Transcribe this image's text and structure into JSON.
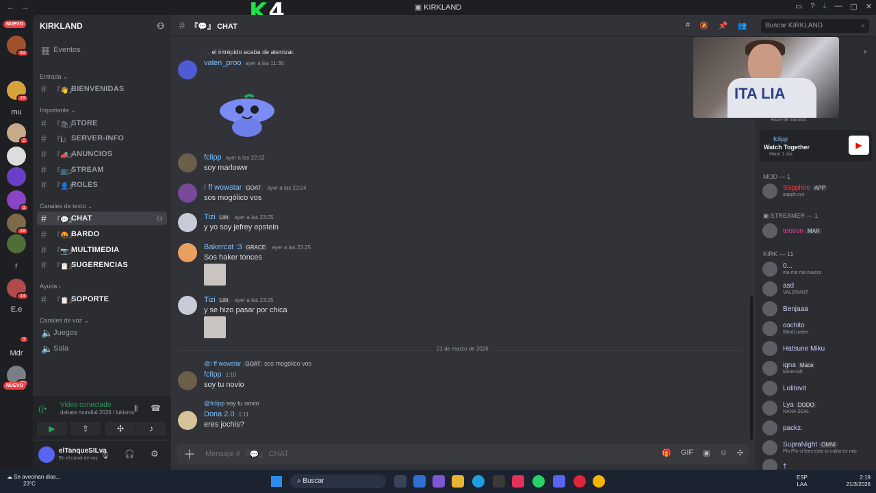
{
  "window": {
    "title": "KIRKLAND",
    "overlay_logo_k": "K",
    "overlay_logo_4": "4"
  },
  "rail": {
    "new_badge": "NUEVO",
    "servers": [
      {
        "label": "",
        "badge": "51",
        "color": "#a0522d"
      },
      {
        "label": "",
        "badge": "19",
        "color": "#d8a23a"
      },
      {
        "label": "mu",
        "badge": "",
        "color": "#1e1f22"
      },
      {
        "label": "",
        "badge": "2",
        "color": "#c8a98a"
      },
      {
        "label": "",
        "badge": "",
        "color": "#ddd"
      },
      {
        "label": "",
        "badge": "",
        "color": "#6a3fc7"
      },
      {
        "label": "",
        "badge": "1",
        "color": "#8a44c7"
      },
      {
        "label": "",
        "badge": "18",
        "color": "#7c6a4a"
      },
      {
        "label": "",
        "badge": "",
        "color": "#4f6e3a"
      },
      {
        "label": "r",
        "badge": "",
        "color": "#1e1f22"
      },
      {
        "label": "",
        "badge": "14",
        "color": "#b24a4a"
      },
      {
        "label": "E.e",
        "badge": "",
        "color": "#1e1f22"
      },
      {
        "label": "",
        "badge": "1",
        "color": "#1e1f22"
      },
      {
        "label": "Mdr",
        "badge": "",
        "color": "#1e1f22"
      },
      {
        "label": "",
        "badge": "20",
        "color": "#7a7f86"
      }
    ]
  },
  "sidebar": {
    "guild_name": "KIRKLAND",
    "events": "Eventos",
    "categories": {
      "entrada": "Entrada",
      "importante": "Importante",
      "texto": "Canales de texto",
      "ayuda": "Ayuda",
      "voz": "Canales de voz"
    },
    "channels": {
      "bienvenidas": "BIENVENIDAS",
      "store": "STORE",
      "server_info": "SERVER-INFO",
      "anuncios": "ANUNCIOS",
      "stream": "STREAM",
      "roles": "ROLES",
      "chat": "CHAT",
      "bardo": "BARDO",
      "multimedia": "MULTIMEDIA",
      "sugerencias": "SUGERENCIAS",
      "soporte": "SOPORTE",
      "juegos": "Juegos",
      "sala": "Sala"
    },
    "voice": {
      "status": "Video conectado",
      "detail": "debate mundial 2026 / lukismo"
    },
    "user": {
      "name": "elTanqueSILva",
      "status": "En el canal de voz"
    }
  },
  "header": {
    "channel": "CHAT",
    "search_placeholder": "Buscar KIRKLAND"
  },
  "messages": {
    "system": "el intrépido acaba de aterrizar.",
    "m1": {
      "user": "valen_proo",
      "time": "ayer a las 11:30"
    },
    "m2": {
      "user": "fclipp",
      "time": "ayer a las 22:52",
      "text": "soy marloww"
    },
    "m3": {
      "user": "! ff wowstar",
      "tag": "GOAT",
      "time": "ayer a las 23:24",
      "text": "sos mogólico vos"
    },
    "m4": {
      "user": "Tizi",
      "tag": "Lith",
      "time": "ayer a las 23:25",
      "text": "y yo soy jefrey epstein"
    },
    "m5": {
      "user": "Bakercat :3",
      "tag": "GRACE",
      "time": "ayer a las 23:25",
      "text": "Sos haker tonces"
    },
    "m6": {
      "user": "Tizi",
      "tag": "Lith",
      "time": "ayer a las 23:25",
      "text": "y se hizo pasar por chica"
    },
    "date_divider": "21 de marzo de 2026",
    "m7": {
      "reply_user": "@! ff wowstar",
      "reply_tag": "GOAT",
      "reply_text": "sos mogólico vos",
      "user": "fclipp",
      "time": "1:10",
      "text": "soy tu novio"
    },
    "m8": {
      "reply_user": "@fclipp",
      "reply_text": "soy tu novio",
      "user": "Dona 2.0",
      "time": "1:11",
      "text": "eres jochis?"
    }
  },
  "composer": {
    "placeholder": "Mensaje #",
    "channel": "CHAT"
  },
  "members": {
    "activity_time": "Hace 58 minutos",
    "activity": {
      "user": "fclipp",
      "title": "Watch Together",
      "time": "Hace 1 día"
    },
    "sections": {
      "mod": "MOD — 1",
      "streamer": "STREAMER — 1",
      "kirk": "KIRK — 11"
    },
    "mod": [
      {
        "name": "Sapphire",
        "tag": "APP",
        "status": "sapph.xyz",
        "color": "#f23f43"
      }
    ],
    "streamer": [
      {
        "name": "teoson",
        "tag": "MAR",
        "status": "",
        "color": "#eb459e"
      }
    ],
    "kirk": [
      {
        "name": "0...",
        "status": "ma ma ma maicra"
      },
      {
        "name": "asd",
        "status": "VALORANT"
      },
      {
        "name": "Benjaaa",
        "status": ""
      },
      {
        "name": "cochito",
        "status": "tModLoader"
      },
      {
        "name": "Hatsune Miku",
        "status": ""
      },
      {
        "name": "igna",
        "tag": "Mace",
        "status": "Minecraft"
      },
      {
        "name": "Lolitovit",
        "status": ""
      },
      {
        "name": "Lya",
        "tag": "DODO",
        "status": "NANA SEAL"
      },
      {
        "name": "packz.",
        "status": ""
      },
      {
        "name": "SupraNight",
        "tag": "OMNI",
        "status": "Plo Plo si lees esto tu culito es mio"
      },
      {
        "name": "†",
        "status": ""
      }
    ]
  },
  "video_overlay": {
    "shirt_text": "ITA LIA"
  },
  "taskbar": {
    "weather_title": "Se avecinan días...",
    "weather_temp": "23°C",
    "search": "Buscar",
    "lang1": "ESP",
    "lang2": "LAA",
    "time": "2:19",
    "date": "21/3/2026"
  }
}
